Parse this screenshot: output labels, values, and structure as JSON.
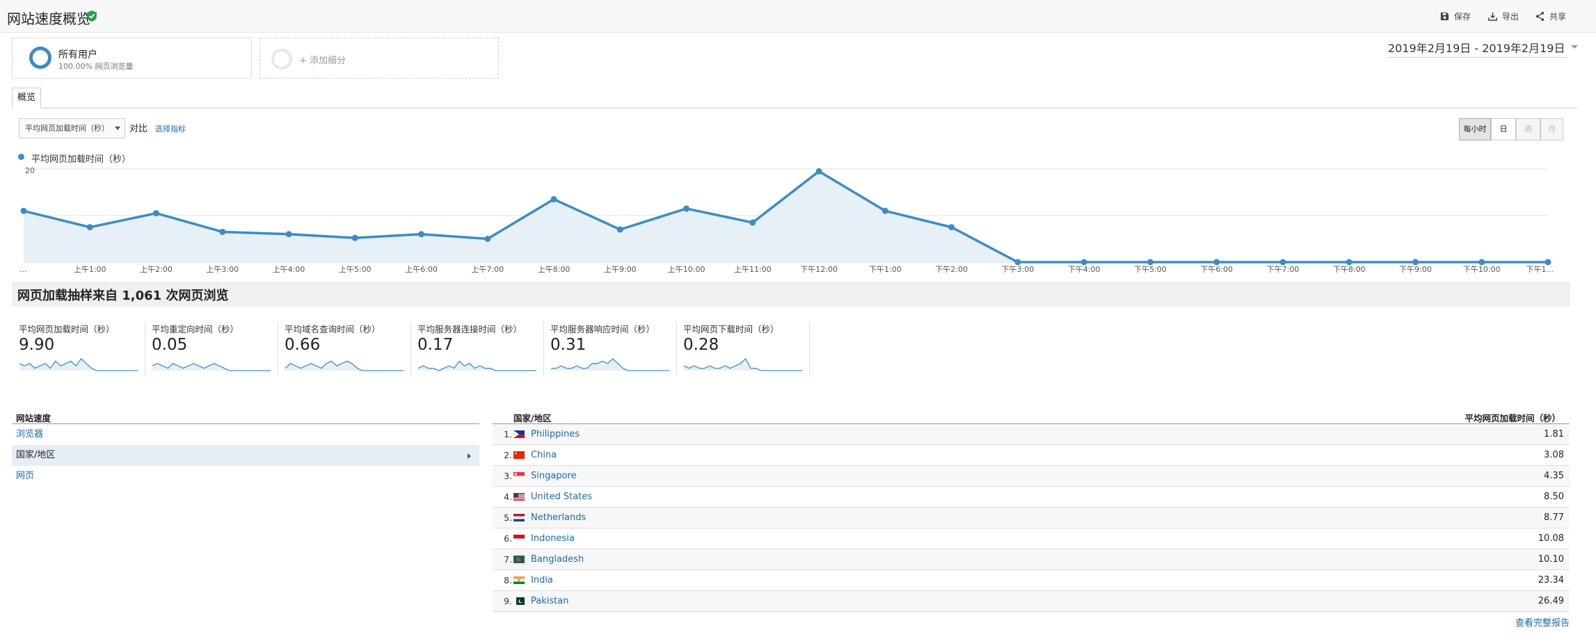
{
  "header": {
    "title": "网站速度概览",
    "actions": [
      {
        "label": "保存",
        "icon": "save-icon"
      },
      {
        "label": "导出",
        "icon": "export-icon"
      },
      {
        "label": "共享",
        "icon": "share-icon"
      }
    ]
  },
  "segments": {
    "all": {
      "name": "所有用户",
      "desc": "100.00% 网页浏览量"
    },
    "add_label": "+ 添加细分"
  },
  "date_range": "2019年2月19日 - 2019年2月19日",
  "tabs": [
    {
      "label": "概览",
      "active": true
    }
  ],
  "controls": {
    "metric_select": "平均网页加载时间（秒）",
    "vs_label": "对比",
    "select_metric_link": "选择指标",
    "granularity": [
      {
        "label": "每小时",
        "active": true
      },
      {
        "label": "日",
        "active": false
      },
      {
        "label": "周",
        "active": false,
        "disabled": true
      },
      {
        "label": "月",
        "active": false,
        "disabled": true
      }
    ]
  },
  "colors": {
    "series": "#3d8cc3",
    "link": "#1a6aa8",
    "accent_check": "#2e9e47"
  },
  "chart_data": {
    "type": "area",
    "series": [
      {
        "name": "平均网页加载时间（秒）",
        "values": [
          11,
          7.5,
          10.5,
          6.5,
          6,
          5.2,
          6,
          5,
          13.5,
          7,
          11.5,
          8.5,
          19.5,
          11,
          7.5,
          0,
          0,
          0,
          0,
          0,
          0,
          0,
          0,
          0
        ]
      }
    ],
    "categories": [
      "...",
      "上午1:00",
      "上午2:00",
      "上午3:00",
      "上午4:00",
      "上午5:00",
      "上午6:00",
      "上午7:00",
      "上午8:00",
      "上午9:00",
      "上午10:00",
      "上午11:00",
      "下午12:00",
      "下午1:00",
      "下午2:00",
      "下午3:00",
      "下午4:00",
      "下午5:00",
      "下午6:00",
      "下午7:00",
      "下午8:00",
      "下午9:00",
      "下午10:00",
      "下午1..."
    ],
    "y_ticks": [
      "20",
      "10"
    ],
    "ylim": [
      0,
      20
    ],
    "grid": true
  },
  "summary": {
    "title": "网页加载抽样来自 1,061 次网页浏览"
  },
  "metrics": [
    {
      "label": "平均网页加载时间（秒）",
      "value": "9.90"
    },
    {
      "label": "平均重定向时间（秒）",
      "value": "0.05"
    },
    {
      "label": "平均域名查询时间（秒）",
      "value": "0.66"
    },
    {
      "label": "平均服务器连接时间（秒）",
      "value": "0.17"
    },
    {
      "label": "平均服务器响应时间（秒）",
      "value": "0.31"
    },
    {
      "label": "平均网页下载时间（秒）",
      "value": "0.28"
    }
  ],
  "site_speed": {
    "heading": "网站速度",
    "items": [
      "浏览器",
      "国家/地区",
      "网页"
    ]
  },
  "country_table": {
    "col_country": "国家/地区",
    "col_value": "平均网页加载时间（秒）",
    "rows": [
      {
        "num": "1.",
        "name": "Philippines",
        "value": "1.81"
      },
      {
        "num": "2.",
        "name": "China",
        "value": "3.08"
      },
      {
        "num": "3.",
        "name": "Singapore",
        "value": "4.35"
      },
      {
        "num": "4.",
        "name": "United States",
        "value": "8.50"
      },
      {
        "num": "5.",
        "name": "Netherlands",
        "value": "8.77"
      },
      {
        "num": "6.",
        "name": "Indonesia",
        "value": "10.08"
      },
      {
        "num": "7.",
        "name": "Bangladesh",
        "value": "10.10"
      },
      {
        "num": "8.",
        "name": "India",
        "value": "23.34"
      },
      {
        "num": "9.",
        "name": "Pakistan",
        "value": "26.49"
      }
    ]
  },
  "full_report_link": "查看完整报告"
}
